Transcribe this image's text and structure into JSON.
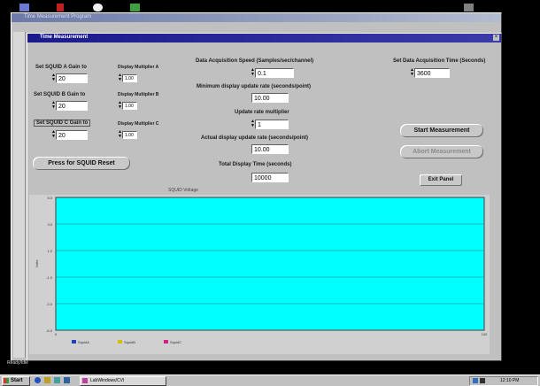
{
  "outer_window": {
    "title": "Time Measurement Program"
  },
  "inner_window": {
    "title": "Time Measurement"
  },
  "left_column": {
    "gain_a": {
      "label": "Set SQUID A Gain to",
      "value": "20"
    },
    "gain_b": {
      "label": "Set SQUID B Gain to",
      "value": "20"
    },
    "gain_c": {
      "label": "Set SQUID C Gain to",
      "value": "20"
    },
    "mult_a": {
      "label": "Display Multiplier A",
      "value": "1.00"
    },
    "mult_b": {
      "label": "Display Multiplier B",
      "value": "1.00"
    },
    "mult_c": {
      "label": "Display Multiplier C",
      "value": "1.00"
    },
    "reset_button": "Press for SQUID Reset"
  },
  "center_column": {
    "acq_speed": {
      "label": "Data Acquisition Speed (Samples/sec/channel)",
      "value": "0.1"
    },
    "min_update": {
      "label": "Minimum display update rate (seconds/point)",
      "value": "10.00"
    },
    "update_mult": {
      "label": "Update rate multiplier",
      "value": "1"
    },
    "actual_update": {
      "label": "Actual display update rate (seconds/point)",
      "value": "10.00"
    },
    "total_time": {
      "label": "Total Display Time (seconds)",
      "value": "10000"
    }
  },
  "right_column": {
    "acq_time": {
      "label": "Set Data Acquisition Time (Seconds)",
      "value": "3600"
    },
    "start_button": "Start Measurement",
    "abort_button": "Abort Measurement",
    "exit_button": "Exit Panel"
  },
  "chart_data": {
    "type": "line",
    "title": "SQUID Voltage",
    "ylabel": "Volts",
    "xlabel": "",
    "xlim": [
      0,
      100
    ],
    "ylim": [
      -5,
      5
    ],
    "y_ticks": [
      "5.0",
      "3.0",
      "1.0",
      "-1.0",
      "-3.0",
      "-5.0"
    ],
    "x_ticks": [
      "0",
      "100"
    ],
    "grid": true,
    "legend_position": "bottom",
    "background": "#00ffff",
    "series": [
      {
        "name": "SquidA",
        "color": "#2040c0",
        "values": []
      },
      {
        "name": "SquidB",
        "color": "#d0c000",
        "values": []
      },
      {
        "name": "SquidC",
        "color": "#d02080",
        "values": []
      }
    ]
  },
  "status_bar": {
    "text": "Ready/Idle"
  },
  "taskbar": {
    "start": "Start",
    "task": "LabWindows/CVI",
    "clock": "12:10 PM"
  },
  "colors": {
    "title_active": "#1a1a8c",
    "window_face": "#c0c0c0",
    "plot_bg": "#00ffff",
    "desktop": "#000000"
  }
}
